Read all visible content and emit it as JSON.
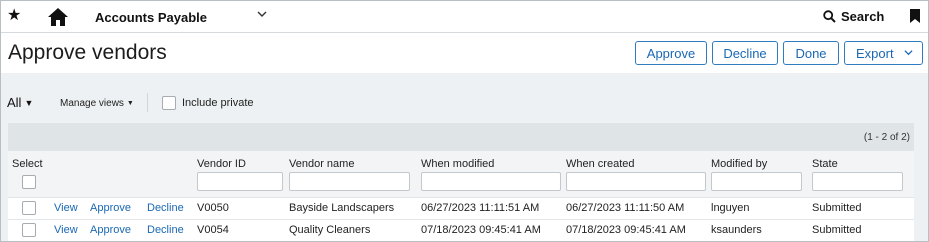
{
  "topbar": {
    "favorite_icon": "star-icon",
    "home_icon": "home-icon",
    "module": "Accounts Payable",
    "search_label": "Search",
    "bookmark_icon": "bookmark-icon"
  },
  "header": {
    "title": "Approve vendors",
    "buttons": {
      "approve": "Approve",
      "decline": "Decline",
      "done": "Done",
      "export": "Export"
    }
  },
  "toolbar": {
    "view": "All",
    "manage_views": "Manage views",
    "include_private": "Include private",
    "include_private_checked": false
  },
  "grid": {
    "pager": "(1 - 2 of 2)",
    "columns": {
      "select": "Select",
      "vendor_id": "Vendor ID",
      "vendor_name": "Vendor name",
      "when_modified": "When modified",
      "when_created": "When created",
      "modified_by": "Modified by",
      "state": "State"
    },
    "rows": [
      {
        "actions": {
          "view": "View",
          "approve": "Approve",
          "decline": "Decline"
        },
        "vendor_id": "V0050",
        "vendor_name": "Bayside Landscapers",
        "when_modified": "06/27/2023 11:11:51 AM",
        "when_created": "06/27/2023 11:11:50 AM",
        "modified_by": "lnguyen",
        "state": "Submitted"
      },
      {
        "actions": {
          "view": "View",
          "approve": "Approve",
          "decline": "Decline"
        },
        "vendor_id": "V0054",
        "vendor_name": "Quality Cleaners",
        "when_modified": "07/18/2023 09:45:41 AM",
        "when_created": "07/18/2023 09:45:41 AM",
        "modified_by": "ksaunders",
        "state": "Submitted"
      }
    ]
  },
  "colors": {
    "accent": "#1a68b4",
    "panel_bg": "#eef1f3",
    "header_strip": "#dfe4e7"
  }
}
